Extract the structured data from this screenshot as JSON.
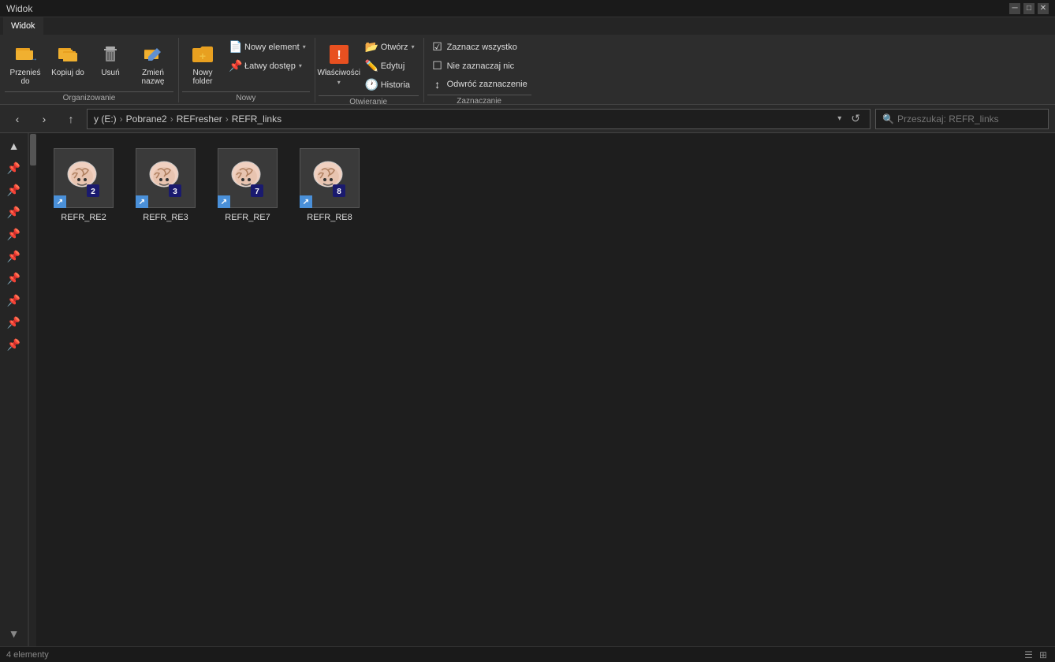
{
  "titleBar": {
    "title": "Widok",
    "controls": [
      "minimize",
      "maximize",
      "close"
    ]
  },
  "ribbonTabs": [
    {
      "label": "Widok",
      "active": true
    }
  ],
  "ribbonGroups": [
    {
      "name": "Organizowanie",
      "buttons": [
        {
          "type": "large",
          "icon": "📋",
          "label": "Przenieś\ndo"
        },
        {
          "type": "large",
          "icon": "📄",
          "label": "Kopiuj\ndo"
        },
        {
          "type": "large",
          "icon": "✕",
          "label": "Usuń"
        },
        {
          "type": "large",
          "icon": "✏️",
          "label": "Zmień\nnazwę"
        }
      ]
    },
    {
      "name": "Nowy",
      "buttons": [
        {
          "type": "large",
          "icon": "📁",
          "label": "Nowy folder"
        },
        {
          "type": "small-group",
          "items": [
            {
              "icon": "📄",
              "label": "Nowy element",
              "dropdown": true
            },
            {
              "icon": "📌",
              "label": "Łatwy dostęp",
              "dropdown": true
            }
          ]
        }
      ]
    },
    {
      "name": "Otwieranie",
      "buttons": [
        {
          "type": "large",
          "icon": "🏷️",
          "label": "Właściwości",
          "dropdown": true
        },
        {
          "type": "small-group",
          "items": [
            {
              "icon": "📂",
              "label": "Otwórz",
              "dropdown": true
            },
            {
              "icon": "✏️",
              "label": "Edytuj"
            },
            {
              "icon": "🕐",
              "label": "Historia"
            }
          ]
        }
      ]
    },
    {
      "name": "Zaznaczanie",
      "buttons": [
        {
          "type": "small-group",
          "items": [
            {
              "icon": "☑",
              "label": "Zaznacz wszystko"
            },
            {
              "icon": "☐",
              "label": "Nie zaznaczaj nic"
            },
            {
              "icon": "↕",
              "label": "Odwróć zaznaczenie"
            }
          ]
        }
      ]
    }
  ],
  "addressBar": {
    "pathSegments": [
      "y (E:)",
      "Pobrane2",
      "REFresher",
      "REFR_links"
    ],
    "searchPlaceholder": "Przeszukaj: REFR_links"
  },
  "leftPanel": {
    "items": [
      {
        "icon": "▲",
        "pinned": true
      },
      {
        "icon": "📌",
        "pinned": true
      },
      {
        "icon": "📌",
        "pinned": false
      },
      {
        "icon": "📌",
        "pinned": false
      },
      {
        "icon": "📌",
        "pinned": false
      },
      {
        "icon": "📌",
        "pinned": false
      },
      {
        "icon": "📌",
        "pinned": false
      },
      {
        "icon": "📌",
        "pinned": false
      },
      {
        "icon": "📌",
        "pinned": false
      },
      {
        "icon": "📌",
        "pinned": false
      },
      {
        "icon": "▼",
        "pinned": false
      }
    ]
  },
  "files": [
    {
      "name": "REFR_RE2",
      "type": "shortcut"
    },
    {
      "name": "REFR_RE3",
      "type": "shortcut"
    },
    {
      "name": "REFR_RE7",
      "type": "shortcut"
    },
    {
      "name": "REFR_RE8",
      "type": "shortcut"
    }
  ],
  "statusBar": {
    "itemCount": "4 elementy",
    "viewMode": "tiles"
  }
}
